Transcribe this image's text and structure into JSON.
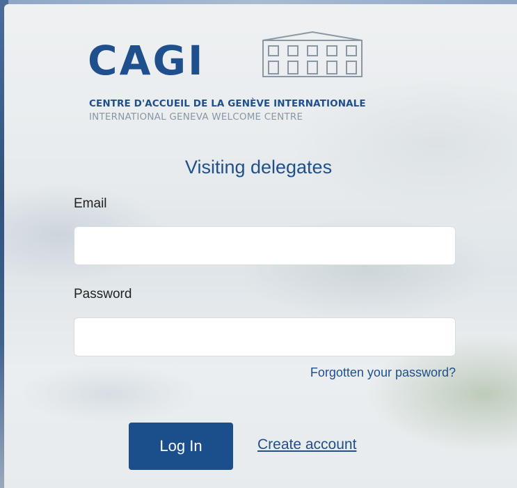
{
  "logo": {
    "wordmark": "CAGI",
    "line1": "CENTRE D'ACCUEIL DE LA GENÈVE INTERNATIONALE",
    "line2": "INTERNATIONAL GENEVA WELCOME CENTRE",
    "icon": "building-icon",
    "brand_color": "#1f4f8c",
    "subtitle_color": "#8a97a3"
  },
  "form": {
    "title": "Visiting delegates",
    "email_label": "Email",
    "email_value": "",
    "email_placeholder": "",
    "password_label": "Password",
    "password_value": "",
    "password_placeholder": "",
    "forgot_link": "Forgotten your password?",
    "login_button": "Log In",
    "create_account_link": "Create account",
    "button_color": "#1a4f8c"
  }
}
